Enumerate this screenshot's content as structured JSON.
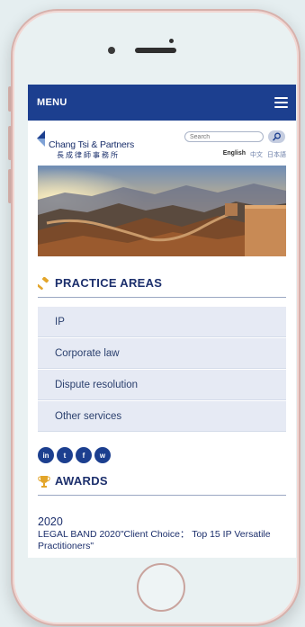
{
  "nav": {
    "menu_label": "MENU"
  },
  "brand": {
    "name_en": "Chang Tsi & Partners",
    "name_cn": "長成律師事務所"
  },
  "search": {
    "placeholder": "Search"
  },
  "languages": [
    {
      "label": "English",
      "active": true
    },
    {
      "label": "中文",
      "active": false
    },
    {
      "label": "日本語",
      "active": false
    }
  ],
  "practice_areas": {
    "title": "PRACTICE AREAS",
    "items": [
      "IP",
      "Corporate law",
      "Dispute resolution",
      "Other services"
    ]
  },
  "social": [
    {
      "icon": "linkedin-icon",
      "glyph": "in"
    },
    {
      "icon": "twitter-icon",
      "glyph": "t"
    },
    {
      "icon": "facebook-icon",
      "glyph": "f"
    },
    {
      "icon": "wechat-icon",
      "glyph": "w"
    }
  ],
  "awards": {
    "title": "AWARDS",
    "year": "2020",
    "text": "LEGAL BAND 2020\"Client Choice： Top 15 IP Versatile Practitioners\""
  },
  "colors": {
    "brand_blue": "#1c3f8f",
    "accent_gold": "#e3a52a",
    "list_bg": "#e6eaf4"
  }
}
